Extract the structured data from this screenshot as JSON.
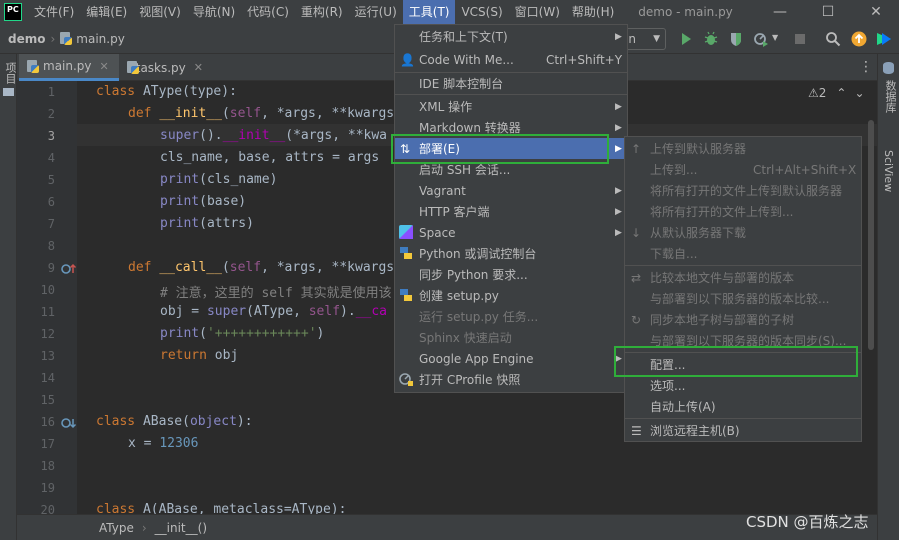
{
  "app": {
    "logo_text": "PC",
    "window_title": "demo - main.py"
  },
  "menubar": [
    {
      "label": "文件(F)"
    },
    {
      "label": "编辑(E)"
    },
    {
      "label": "视图(V)"
    },
    {
      "label": "导航(N)"
    },
    {
      "label": "代码(C)"
    },
    {
      "label": "重构(R)"
    },
    {
      "label": "运行(U)"
    },
    {
      "label": "工具(T)"
    },
    {
      "label": "VCS(S)"
    },
    {
      "label": "窗口(W)"
    },
    {
      "label": "帮助(H)"
    }
  ],
  "window_controls": {
    "minimize": "—",
    "maximize": "☐",
    "close": "✕"
  },
  "navbar": {
    "project": "demo",
    "file": "main.py",
    "run_config": "in"
  },
  "left_strip": {
    "project_label": "项目"
  },
  "right_strip": {
    "database_label": "数据库",
    "sciview_label": "SciView"
  },
  "tabs": [
    {
      "label": "main.py",
      "close": "✕"
    },
    {
      "label": "tasks.py",
      "close": "✕"
    }
  ],
  "editor": {
    "inspection_count": "2",
    "line_numbers": [
      "1",
      "2",
      "3",
      "4",
      "5",
      "6",
      "7",
      "8",
      "9",
      "10",
      "11",
      "12",
      "13",
      "14",
      "15",
      "16",
      "17",
      "18",
      "19",
      "20"
    ],
    "lines": {
      "l1_kw": "class",
      "l1_name": " AType",
      "l1_rest": "(type):",
      "l2_kw": "def",
      "l2_fn": "__init__",
      "l2_open": "(",
      "l2_self": "self",
      "l2_rest": ", *args, **kwargs",
      "l3_bi": "super",
      "l3_mid": "().",
      "l3_dunder": "__init__",
      "l3_rest": "(*args, **kwa",
      "l4": "cls_name, base, attrs = args",
      "l5_bi": "print",
      "l5_rest": "(cls_name)",
      "l6_bi": "print",
      "l6_rest": "(base)",
      "l7_bi": "print",
      "l7_rest": "(attrs)",
      "l9_kw": "def",
      "l9_fn": "__call__",
      "l9_open": "(",
      "l9_self": "self",
      "l9_rest": ", *args, **kwargs",
      "l10": "# 注意，这里的 self 其实就是使用该",
      "l11_a": "obj = ",
      "l11_bi": "super",
      "l11_b": "(AType, ",
      "l11_self": "self",
      "l11_c": ").",
      "l11_dunder": "__ca",
      "l12_bi": "print",
      "l12_open": "(",
      "l12_str": "'++++++++++++'",
      "l12_close": ")",
      "l13_kw": "return",
      "l13_rest": " obj",
      "l16_kw": "class",
      "l16_name": " ABase",
      "l16_open": "(",
      "l16_bi": "object",
      "l16_close": "):",
      "l17_a": "x = ",
      "l17_num": "12306",
      "l20_kw": "class",
      "l20_rest": " A(ABase, metaclass=AType):"
    }
  },
  "statusbar": {
    "class_name": "AType",
    "separator": "›",
    "method_name": "__init__()"
  },
  "watermark": "CSDN @百炼之志",
  "tools_menu": [
    {
      "label": "任务和上下文(T)",
      "submenu": true
    },
    {
      "label": "Code With Me...",
      "shortcut": "Ctrl+Shift+Y",
      "icon": "person-icon"
    },
    {
      "label": "IDE 脚本控制台"
    },
    {
      "label": "XML 操作",
      "submenu": true
    },
    {
      "label": "Markdown 转换器",
      "submenu": true
    },
    {
      "label": "部署(E)",
      "submenu": true,
      "icon": "deploy-icon"
    },
    {
      "label": "启动 SSH 会话..."
    },
    {
      "label": "Vagrant",
      "submenu": true
    },
    {
      "label": "HTTP 客户端",
      "submenu": true
    },
    {
      "label": "Space",
      "submenu": true,
      "icon": "space-icon"
    },
    {
      "label": "Python 或调试控制台",
      "icon": "python-icon"
    },
    {
      "label": "同步 Python 要求..."
    },
    {
      "label": "创建 setup.py",
      "icon": "python-icon"
    },
    {
      "label": "运行 setup.py 任务...",
      "disabled": true
    },
    {
      "label": "Sphinx 快速启动",
      "disabled": true
    },
    {
      "label": "Google App Engine",
      "submenu": true
    },
    {
      "label": "打开 CProfile 快照",
      "icon": "profile-icon"
    }
  ],
  "deploy_menu": [
    {
      "label": "上传到默认服务器",
      "disabled": true,
      "icon": "upload-icon"
    },
    {
      "label": "上传到...",
      "shortcut": "Ctrl+Alt+Shift+X",
      "disabled": true
    },
    {
      "label": "将所有打开的文件上传到默认服务器",
      "disabled": true
    },
    {
      "label": "将所有打开的文件上传到...",
      "disabled": true
    },
    {
      "label": "从默认服务器下载",
      "disabled": true,
      "icon": "download-icon"
    },
    {
      "label": "下载自...",
      "disabled": true
    },
    {
      "label": "比较本地文件与部署的版本",
      "disabled": true,
      "icon": "compare-icon"
    },
    {
      "label": "与部署到以下服务器的版本比较...",
      "disabled": true
    },
    {
      "label": "同步本地子树与部署的子树",
      "disabled": true,
      "icon": "sync-icon"
    },
    {
      "label": "与部署到以下服务器的版本同步(S)...",
      "disabled": true
    },
    {
      "label": "配置..."
    },
    {
      "label": "选项..."
    },
    {
      "label": "自动上传(A)"
    },
    {
      "label": "浏览远程主机(B)",
      "icon": "remote-host-icon"
    }
  ],
  "colors": {
    "accent": "#4b6eaf",
    "highlight_box": "#2fae3a",
    "menubar_bg": "#3c3f41",
    "editor_bg": "#2b2b2b"
  }
}
